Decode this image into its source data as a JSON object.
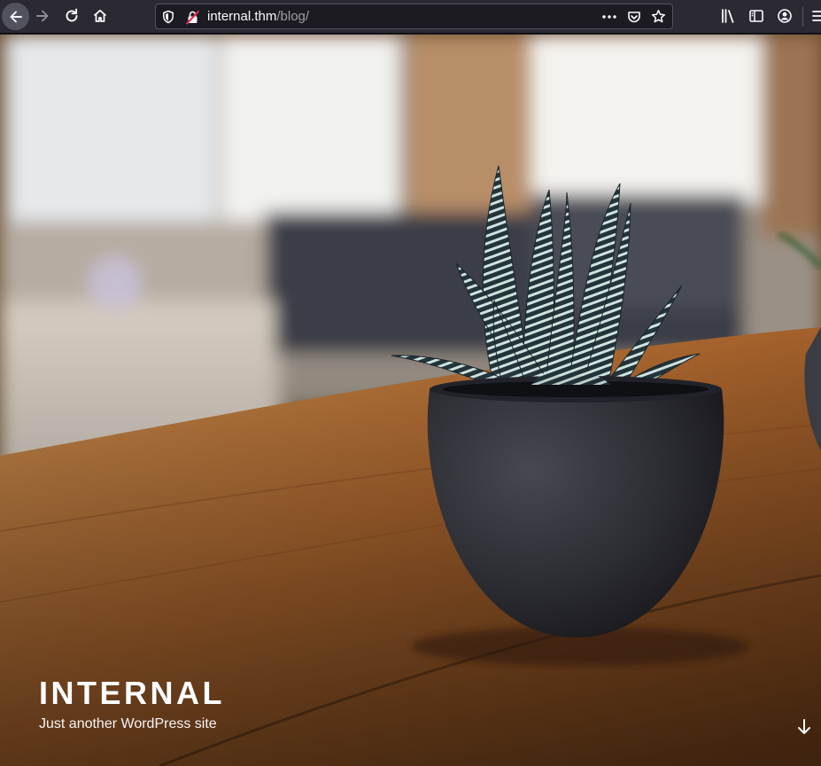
{
  "browser": {
    "url_host": "internal.thm",
    "url_path": "/blog/",
    "icons": {
      "back": "arrow-left-icon",
      "forward": "arrow-right-icon",
      "reload": "reload-icon",
      "home": "home-icon",
      "tracking_protection": "shield-icon",
      "connection": "insecure-lock-icon",
      "page_actions": "three-dots-icon",
      "pocket": "pocket-icon",
      "bookmark": "star-icon",
      "library": "library-icon",
      "sidebar": "sidebar-icon",
      "account": "account-icon",
      "menu": "hamburger-menu-icon"
    }
  },
  "site": {
    "title": "INTERNAL",
    "description": "Just another WordPress site",
    "scroll_icon": "arrow-down-icon"
  },
  "colors": {
    "toolbar": "#2b2a33",
    "urlbar": "#1c1b22",
    "text": "#ffffff"
  }
}
